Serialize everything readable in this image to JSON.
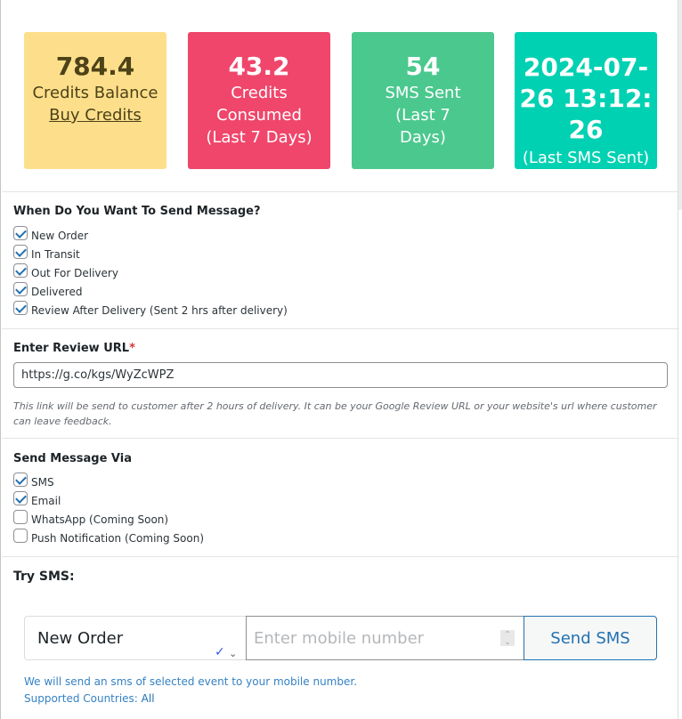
{
  "stats": {
    "credits_balance": {
      "value": "784.4",
      "label": "Credits Balance",
      "link": "Buy Credits",
      "color": "#fddf8b"
    },
    "credits_consumed": {
      "value": "43.2",
      "label": "Credits Consumed (Last 7 Days)",
      "color": "#f0466b"
    },
    "sms_sent": {
      "value": "54",
      "label": "SMS Sent (Last 7 Days)",
      "color": "#4bc88e"
    },
    "last_sms": {
      "value": "2024-07-26 13:12:26",
      "label": "(Last SMS Sent)",
      "color": "#00d1b2"
    }
  },
  "events": {
    "title": "When Do You Want To Send Message?",
    "items": [
      {
        "label": "New Order",
        "checked": true
      },
      {
        "label": "In Transit",
        "checked": true
      },
      {
        "label": "Out For Delivery",
        "checked": true
      },
      {
        "label": "Delivered",
        "checked": true
      },
      {
        "label": "Review After Delivery (Sent 2 hrs after delivery)",
        "checked": true
      }
    ]
  },
  "review": {
    "label": "Enter Review URL",
    "required_mark": "*",
    "value": "https://g.co/kgs/WyZcWPZ",
    "hint": "This link will be send to customer after 2 hours of delivery. It can be your Google Review URL or your website's url where customer can leave feedback."
  },
  "channels": {
    "title": "Send Message Via",
    "items": [
      {
        "label": "SMS",
        "checked": true
      },
      {
        "label": "Email",
        "checked": true
      },
      {
        "label": "WhatsApp (Coming Soon)",
        "checked": false
      },
      {
        "label": "Push Notification (Coming Soon)",
        "checked": false
      }
    ]
  },
  "try_sms": {
    "title": "Try SMS:",
    "selected_event": "New Order",
    "mobile_placeholder": "Enter mobile number",
    "button": "Send SMS",
    "note": "We will send an sms of selected event to your mobile number.",
    "countries_label": "Supported Countries:",
    "countries_value": "All"
  }
}
